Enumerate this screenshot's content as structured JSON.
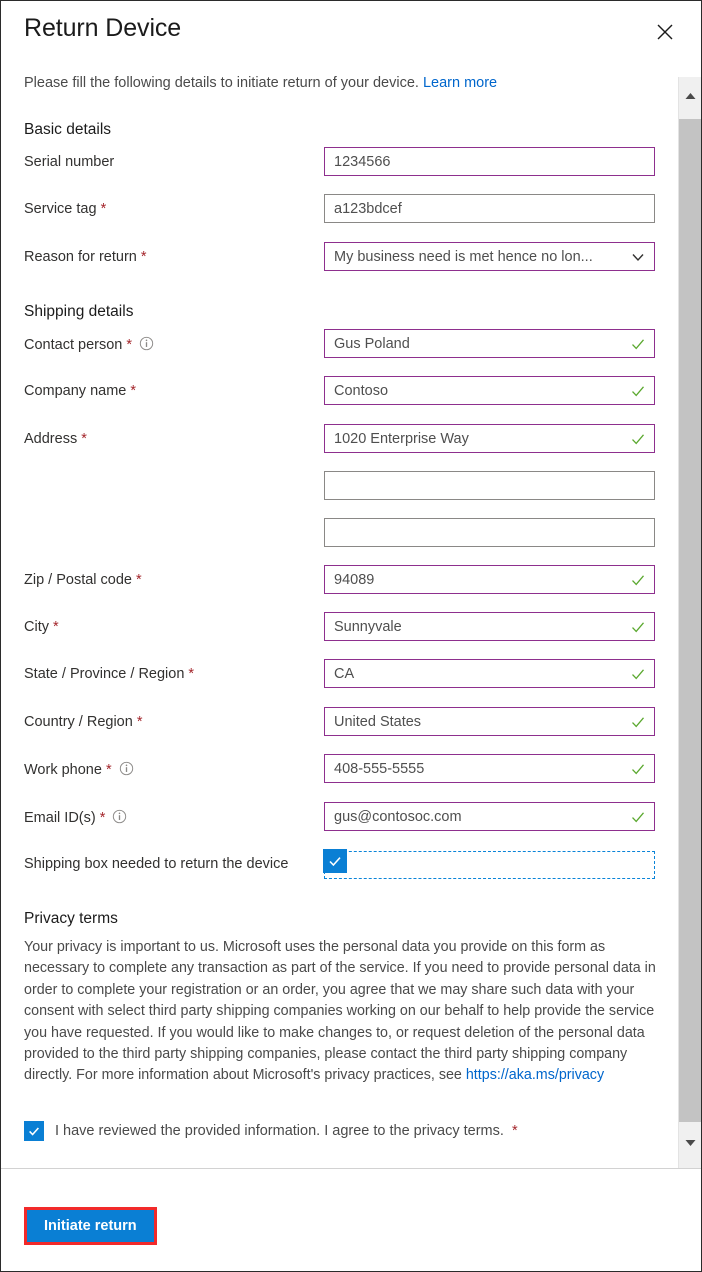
{
  "dialog": {
    "title": "Return Device",
    "close_icon": "close-icon",
    "intro_text": "Please fill the following details to initiate return of your device.",
    "intro_link": "Learn more"
  },
  "basic_details": {
    "section_title": "Basic details",
    "fields": [
      {
        "label": "Serial number",
        "required": false,
        "value": "1234566",
        "state": "accent",
        "control": "textbox",
        "info": false
      },
      {
        "label": "Service tag",
        "required": true,
        "value": "a123bdcef",
        "state": "default",
        "control": "textbox",
        "info": false
      },
      {
        "label": "Reason for return",
        "required": true,
        "value": "My business need is met hence no lon...",
        "state": "accent",
        "control": "dropdown",
        "info": false
      }
    ]
  },
  "shipping_details": {
    "section_title": "Shipping details",
    "fields": [
      {
        "label": "Contact person",
        "required": true,
        "value": "Gus Poland",
        "state": "validated",
        "control": "textbox",
        "info": true
      },
      {
        "label": "Company name",
        "required": true,
        "value": "Contoso",
        "state": "validated",
        "control": "textbox",
        "info": false
      },
      {
        "label": "Address",
        "required": true,
        "value": "1020 Enterprise Way",
        "state": "validated",
        "control": "textbox",
        "info": false
      },
      {
        "label": "",
        "required": false,
        "value": "",
        "state": "default",
        "control": "textbox",
        "info": false
      },
      {
        "label": "",
        "required": false,
        "value": "",
        "state": "default",
        "control": "textbox",
        "info": false
      },
      {
        "label": "Zip / Postal code",
        "required": true,
        "value": "94089",
        "state": "validated",
        "control": "textbox",
        "info": false
      },
      {
        "label": "City",
        "required": true,
        "value": "Sunnyvale",
        "state": "validated",
        "control": "textbox",
        "info": false
      },
      {
        "label": "State / Province / Region",
        "required": true,
        "value": "CA",
        "state": "validated",
        "control": "textbox",
        "info": false
      },
      {
        "label": "Country / Region",
        "required": true,
        "value": "United States",
        "state": "validated",
        "control": "textbox",
        "info": false
      },
      {
        "label": "Work phone",
        "required": true,
        "value": "408-555-5555",
        "state": "validated",
        "control": "textbox",
        "info": true
      },
      {
        "label": "Email ID(s)",
        "required": true,
        "value": "gus@contosoc.com",
        "state": "validated",
        "control": "textbox",
        "info": true
      }
    ],
    "shipping_box": {
      "label": "Shipping box needed to return the device",
      "checked": true
    }
  },
  "privacy": {
    "section_title": "Privacy terms",
    "body": "Your privacy is important to us. Microsoft uses the personal data you provide on this form as necessary to complete any transaction as part of the service. If you need to provide personal data in order to complete your registration or an order, you agree that we may share such data with your consent with select third party shipping companies working on our behalf to help provide the service you have requested. If you would like to make changes to, or request deletion of the personal data provided to the third party shipping companies, please contact the third party shipping company directly. For more information about Microsoft's privacy practices, see ",
    "link_text": "https://aka.ms/privacy",
    "agreement_label": "I have reviewed the provided information. I agree to the privacy terms.",
    "agreement_checked": true
  },
  "footer": {
    "primary_button": "Initiate return"
  },
  "scrollbar": {
    "up_icon": "caret-up-icon",
    "down_icon": "caret-down-icon"
  },
  "colors": {
    "accent_border": "#8e2f8e",
    "default_border": "#8a8886",
    "validation_check": "#5aa82e",
    "primary_button_bg": "#0a7fd4",
    "highlight_outline": "#f22a2a",
    "link": "#0066cc",
    "required_asterisk": "#a4262c"
  }
}
